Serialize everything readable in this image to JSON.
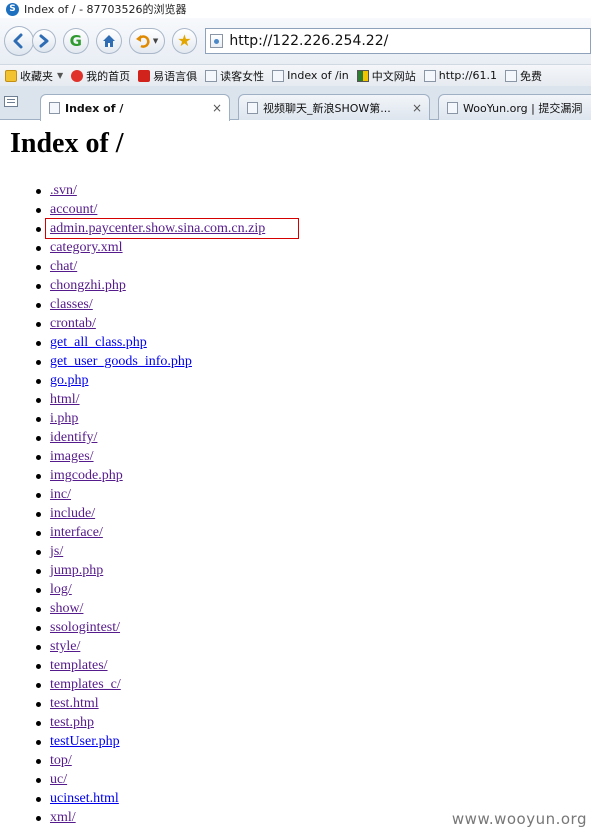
{
  "window": {
    "title": "Index of / - 87703526的浏览器",
    "app_icon": "S"
  },
  "navbar": {
    "back_icon": "back-arrow-icon",
    "forward_icon": "forward-arrow-icon",
    "refresh_icon": "G",
    "home_icon": "home-icon",
    "undo_icon": "undo-icon",
    "favorite_icon": "star-icon",
    "url": "http://122.226.254.22/"
  },
  "bookmarks": [
    {
      "label": "收藏夹",
      "icon": "star-folder-icon"
    },
    {
      "label": "我的首页",
      "icon": "weibo-icon"
    },
    {
      "label": "易语言俱",
      "icon": "red-square-icon"
    },
    {
      "label": "读客女性",
      "icon": "page-icon"
    },
    {
      "label": "Index of /in",
      "icon": "page-icon"
    },
    {
      "label": "中文网站",
      "icon": "flag-icon"
    },
    {
      "label": "http://61.1",
      "icon": "page-icon"
    },
    {
      "label": "免费",
      "icon": "page-icon"
    }
  ],
  "tabs": [
    {
      "label": "Index of /",
      "active": true,
      "close": "×"
    },
    {
      "label": "视频聊天_新浪SHOW第...",
      "active": false,
      "close": "×"
    },
    {
      "label": "WooYun.org | 提交漏洞",
      "active": false,
      "close": ""
    }
  ],
  "page": {
    "heading": "Index of /",
    "entries": [
      {
        "name": ".svn/",
        "visited": true
      },
      {
        "name": "account/",
        "visited": true
      },
      {
        "name": "admin.paycenter.show.sina.com.cn.zip",
        "visited": true,
        "highlighted": true
      },
      {
        "name": "category.xml",
        "visited": true
      },
      {
        "name": "chat/",
        "visited": true
      },
      {
        "name": "chongzhi.php",
        "visited": true
      },
      {
        "name": "classes/",
        "visited": true
      },
      {
        "name": "crontab/",
        "visited": true
      },
      {
        "name": "get_all_class.php",
        "visited": false
      },
      {
        "name": "get_user_goods_info.php",
        "visited": false
      },
      {
        "name": "go.php",
        "visited": false
      },
      {
        "name": "html/",
        "visited": true
      },
      {
        "name": "i.php",
        "visited": true
      },
      {
        "name": "identify/",
        "visited": true
      },
      {
        "name": "images/",
        "visited": true
      },
      {
        "name": "imgcode.php",
        "visited": true
      },
      {
        "name": "inc/",
        "visited": true
      },
      {
        "name": "include/",
        "visited": true
      },
      {
        "name": "interface/",
        "visited": true
      },
      {
        "name": "js/",
        "visited": true
      },
      {
        "name": "jump.php",
        "visited": true
      },
      {
        "name": "log/",
        "visited": true
      },
      {
        "name": "show/",
        "visited": true
      },
      {
        "name": "ssologintest/",
        "visited": true
      },
      {
        "name": "style/",
        "visited": true
      },
      {
        "name": "templates/",
        "visited": true
      },
      {
        "name": "templates_c/",
        "visited": true
      },
      {
        "name": "test.html",
        "visited": true
      },
      {
        "name": "test.php",
        "visited": true
      },
      {
        "name": "testUser.php",
        "visited": false
      },
      {
        "name": "top/",
        "visited": true
      },
      {
        "name": "uc/",
        "visited": true
      },
      {
        "name": "ucinset.html",
        "visited": false
      },
      {
        "name": "xml/",
        "visited": true
      }
    ]
  },
  "colors": {
    "visited_link": "#551a8b",
    "unvisited_link": "#0000ee",
    "highlight_border": "#d40000"
  },
  "watermark": "www.wooyun.org"
}
